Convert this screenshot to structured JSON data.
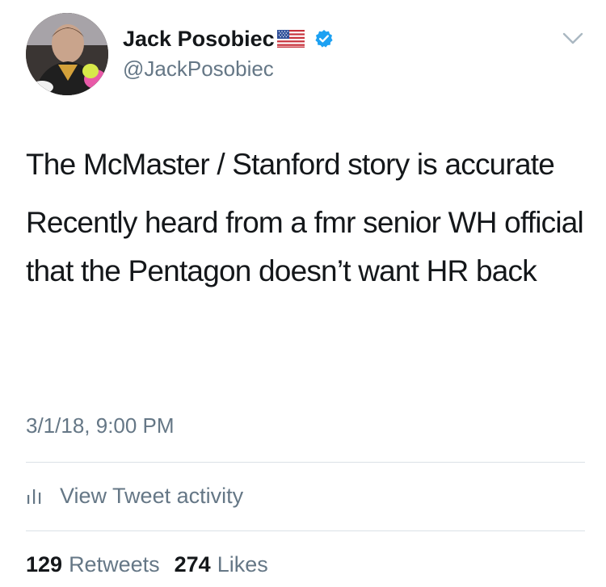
{
  "user": {
    "display_name": "Jack Posobiec",
    "handle": "@JackPosobiec",
    "flag_icon": "us-flag-icon",
    "verified_icon": "verified-badge-icon",
    "verified_color": "#1da1f2"
  },
  "tweet": {
    "paragraphs": [
      "The McMaster / Stanford story is accurate",
      "Recently heard from a fmr senior WH official that the Pentagon doesn’t want HR back"
    ],
    "timestamp": "3/1/18, 9:00 PM"
  },
  "activity": {
    "icon": "bar-chart-icon",
    "label": "View Tweet activity"
  },
  "stats": {
    "retweets_count": "129",
    "retweets_label": "Retweets",
    "likes_count": "274",
    "likes_label": "Likes"
  },
  "menu": {
    "icon": "chevron-down-icon"
  }
}
